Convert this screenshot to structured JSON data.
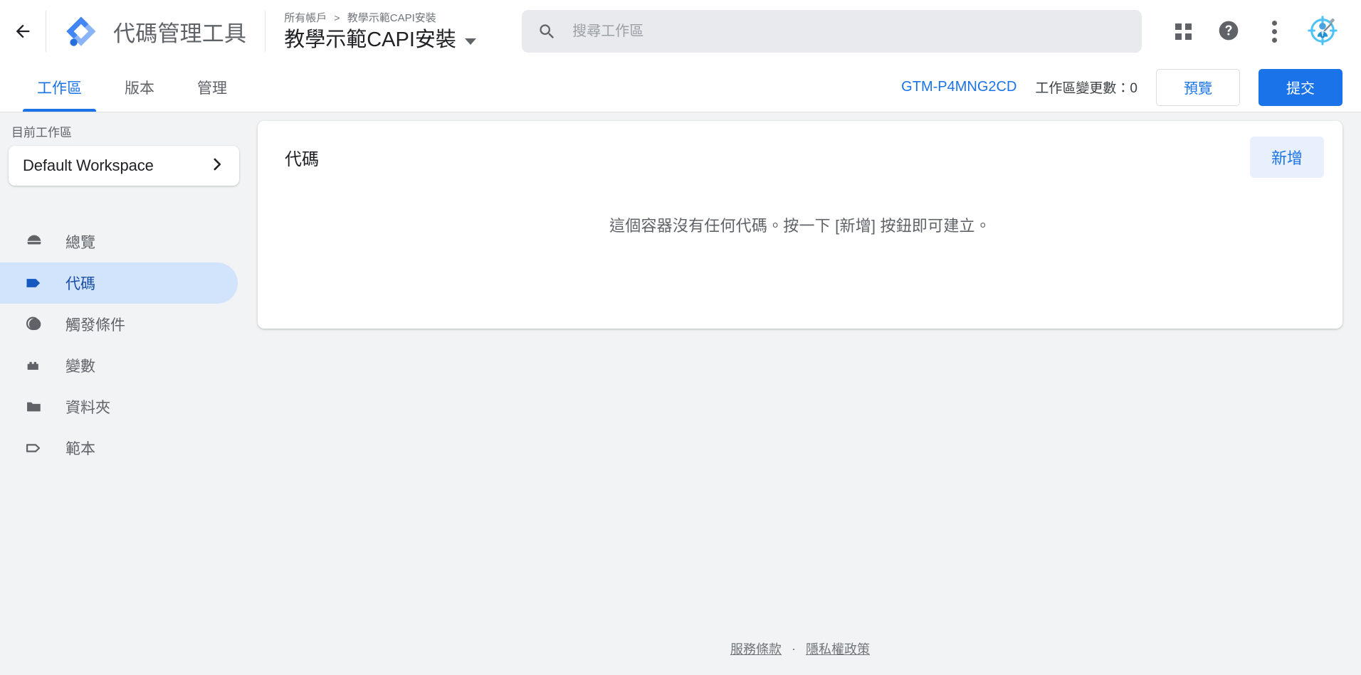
{
  "app": {
    "brand_name": "代碼管理工具",
    "logo_icon": "gtm-diamond-logo",
    "back_icon": "arrow-left-icon"
  },
  "header": {
    "breadcrumb_root": "所有帳戶",
    "breadcrumb_separator": ">",
    "breadcrumb_current": "教學示範CAPI安裝",
    "container_title": "教學示範CAPI安裝",
    "title_caret_icon": "chevron-down-icon"
  },
  "search": {
    "placeholder": "搜尋工作區",
    "value": "",
    "icon": "search-icon"
  },
  "top_actions": [
    {
      "name": "apps-grid",
      "icon": "apps-grid-icon"
    },
    {
      "name": "help",
      "icon": "help-circle-icon"
    },
    {
      "name": "more-options",
      "icon": "more-vert-icon"
    },
    {
      "name": "account-avatar",
      "icon": "avatar-target-person-icon"
    }
  ],
  "tabs": [
    {
      "label": "工作區",
      "active": true
    },
    {
      "label": "版本",
      "active": false
    },
    {
      "label": "管理",
      "active": false
    }
  ],
  "workspace_bar": {
    "container_id": "GTM-P4MNG2CD",
    "changes_label": "工作區變更數：",
    "changes_count": "0",
    "preview_label": "預覽",
    "submit_label": "提交"
  },
  "sidebar": {
    "current_workspace_label": "目前工作區",
    "workspace_name": "Default Workspace",
    "workspace_chevron_icon": "chevron-right-icon",
    "items": [
      {
        "label": "總覽",
        "icon": "overview-icon",
        "active": false
      },
      {
        "label": "代碼",
        "icon": "tag-icon",
        "active": true
      },
      {
        "label": "觸發條件",
        "icon": "trigger-icon",
        "active": false
      },
      {
        "label": "變數",
        "icon": "variable-icon",
        "active": false
      },
      {
        "label": "資料夾",
        "icon": "folder-icon",
        "active": false
      },
      {
        "label": "範本",
        "icon": "template-tag-icon",
        "active": false
      }
    ]
  },
  "main": {
    "card_title": "代碼",
    "add_label": "新增",
    "empty_message": "這個容器沒有任何代碼。按一下 [新增] 按鈕即可建立。"
  },
  "footer": {
    "terms_label": "服務條款",
    "separator": "·",
    "privacy_label": "隱私權政策"
  },
  "colors": {
    "accent_blue": "#1a73e8",
    "active_pill": "#d2e3fc",
    "active_text": "#174ea6",
    "tonal_button_bg": "#e8f0fe",
    "page_bg": "#f1f3f4",
    "search_bg": "#e8eaed",
    "muted_text": "#5f6368"
  }
}
